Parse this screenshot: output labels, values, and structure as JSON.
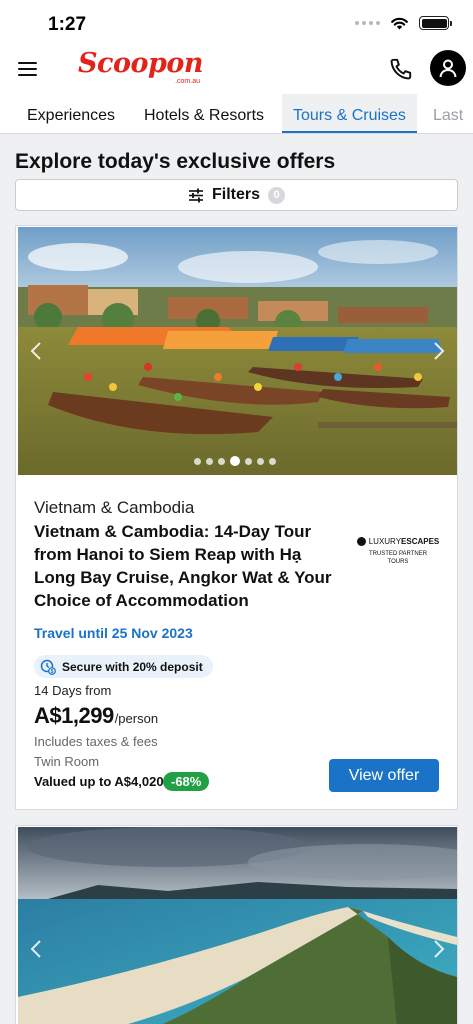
{
  "status_bar": {
    "time": "1:27"
  },
  "header": {
    "logo_text": "Scoopon",
    "logo_sub": ".com.au"
  },
  "tabs": [
    {
      "label": "Experiences"
    },
    {
      "label": "Hotels & Resorts"
    },
    {
      "label": "Tours & Cruises",
      "active": true
    },
    {
      "label": "Last"
    }
  ],
  "main": {
    "title": "Explore today's exclusive offers",
    "filters": {
      "label": "Filters",
      "count": "0"
    }
  },
  "offers": [
    {
      "image_alt": "Colorful boats with lanterns on river in Hoi An",
      "carousel": {
        "total_slides": 7,
        "active_slide": 4
      },
      "location": "Vietnam & Cambodia",
      "title": "Vietnam & Cambodia: 14-Day Tour from Hanoi to Siem Reap with Hạ Long Bay Cruise, Angkor Wat & Your Choice of Accommodation",
      "partner": {
        "brand_light": "LUXURY",
        "brand_bold": "ESCAPES",
        "subtitle_line1": "TRUSTED PARTNER",
        "subtitle_line2": "TOURS"
      },
      "travel_until": "Travel until 25 Nov 2023",
      "deposit": "Secure with 20% deposit",
      "duration": "14 Days from",
      "price": "A$1,299",
      "price_unit": "/person",
      "taxes": "Includes taxes & fees",
      "room": "Twin Room",
      "valued": "Valued up to A$4,020",
      "discount": "-68%",
      "cta": "View offer"
    },
    {
      "image_alt": "Aerial view of coastal beach spit"
    }
  ],
  "colors": {
    "brand_red": "#e2231a",
    "accent_blue": "#1a73c7",
    "discount_green": "#23a046",
    "page_bg": "#eef0f2"
  }
}
